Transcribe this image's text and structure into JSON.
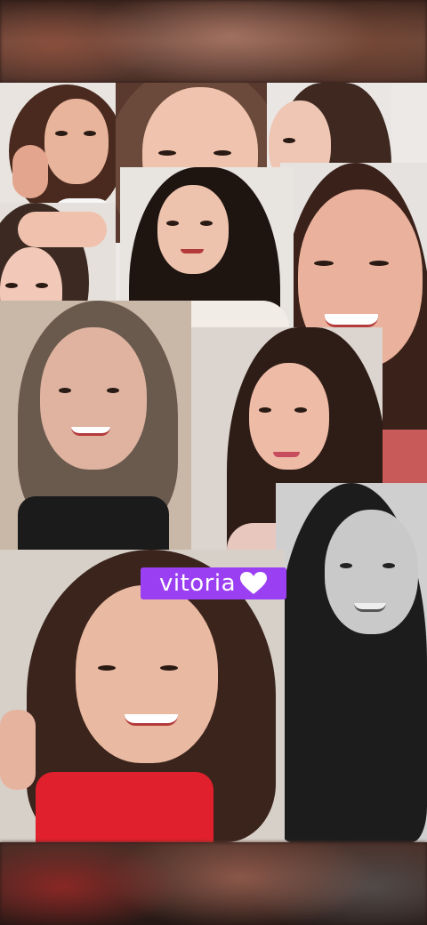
{
  "name_tag": {
    "text": "vitoria",
    "icon": "white-heart-icon",
    "background": "#9b3ff2",
    "text_color": "#ffffff"
  },
  "colors": {
    "collage_background": "#ece9e6",
    "accent": "#9b3ff2"
  }
}
